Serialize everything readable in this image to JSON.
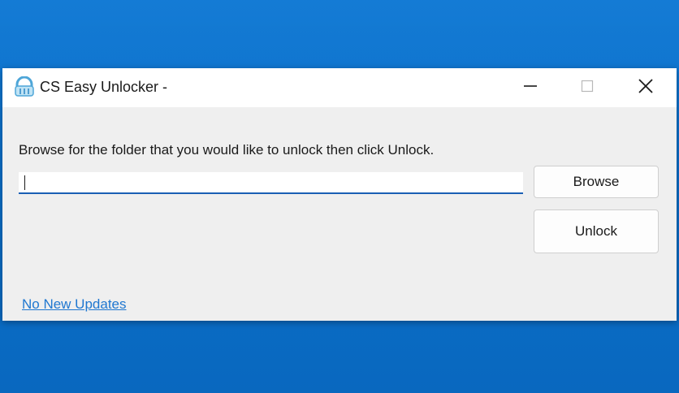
{
  "window": {
    "title": "CS Easy Unlocker -",
    "icon": "app-unlock-icon",
    "controls": {
      "minimize": "minimize-icon",
      "maximize": "maximize-icon",
      "close": "close-icon"
    }
  },
  "main": {
    "instruction": "Browse for the folder that you would like to unlock then click Unlock.",
    "path_input": {
      "value": "",
      "placeholder": ""
    },
    "browse_label": "Browse",
    "unlock_label": "Unlock",
    "updates_link": "No New Updates"
  },
  "colors": {
    "desktop": "#0a6ec8",
    "accent": "#1a5fb4",
    "link": "#1f77d0"
  }
}
